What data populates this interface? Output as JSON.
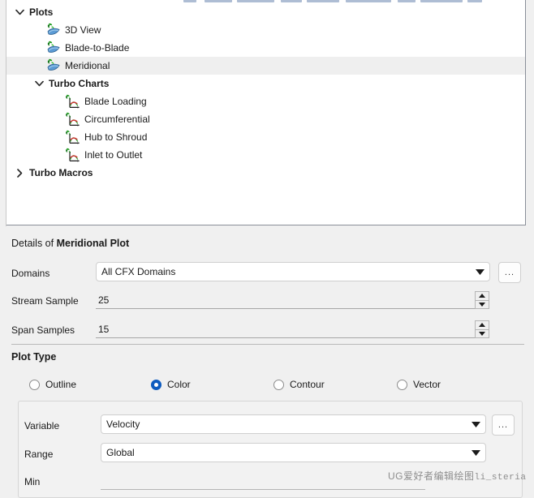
{
  "tree": {
    "nodes": [
      {
        "label": "Plots",
        "level": 1,
        "bold": true,
        "twisty": "chevron-down-icon",
        "icon": "none",
        "selected": false
      },
      {
        "label": "3D View",
        "level": 2,
        "bold": false,
        "twisty": "none",
        "icon": "turbo-plot-icon",
        "selected": false
      },
      {
        "label": "Blade-to-Blade",
        "level": 2,
        "bold": false,
        "twisty": "none",
        "icon": "turbo-plot-icon",
        "selected": false
      },
      {
        "label": "Meridional",
        "level": 2,
        "bold": false,
        "twisty": "none",
        "icon": "turbo-plot-icon",
        "selected": true
      },
      {
        "label": "Turbo Charts",
        "level": 2,
        "bold": true,
        "twisty": "chevron-down-icon",
        "icon": "none",
        "selected": false
      },
      {
        "label": "Blade Loading",
        "level": 3,
        "bold": false,
        "twisty": "none",
        "icon": "turbo-chart-icon",
        "selected": false
      },
      {
        "label": "Circumferential",
        "level": 3,
        "bold": false,
        "twisty": "none",
        "icon": "turbo-chart-icon",
        "selected": false
      },
      {
        "label": "Hub to Shroud",
        "level": 3,
        "bold": false,
        "twisty": "none",
        "icon": "turbo-chart-icon",
        "selected": false
      },
      {
        "label": "Inlet to Outlet",
        "level": 3,
        "bold": false,
        "twisty": "none",
        "icon": "turbo-chart-icon",
        "selected": false
      },
      {
        "label": "Turbo Macros",
        "level": 1,
        "bold": true,
        "twisty": "chevron-right-icon",
        "icon": "none",
        "selected": false
      }
    ]
  },
  "details": {
    "header_prefix": "Details of ",
    "header_object": "Meridional Plot",
    "domains": {
      "label": "Domains",
      "value": "All CFX Domains",
      "more_button": "..."
    },
    "stream_sample": {
      "label": "Stream Sample",
      "value": "25"
    },
    "span_samples": {
      "label": "Span Samples",
      "value": "15"
    },
    "plot_type": {
      "title": "Plot Type",
      "options": [
        {
          "label": "Outline",
          "selected": false
        },
        {
          "label": "Color",
          "selected": true
        },
        {
          "label": "Contour",
          "selected": false
        },
        {
          "label": "Vector",
          "selected": false
        }
      ]
    },
    "variable": {
      "label": "Variable",
      "value": "Velocity",
      "more_button": "..."
    },
    "range": {
      "label": "Range",
      "value": "Global"
    },
    "min": {
      "label": "Min"
    }
  },
  "watermark": {
    "text_cn": "UG爱好者编辑绘图",
    "text_en": "li_steria"
  },
  "colors": {
    "accent": "#0d5bbf",
    "selection_bg": "#efefef",
    "panel_bg": "#f0f0f0",
    "field_bg": "#ffffff",
    "border": "#cfcfcf"
  }
}
